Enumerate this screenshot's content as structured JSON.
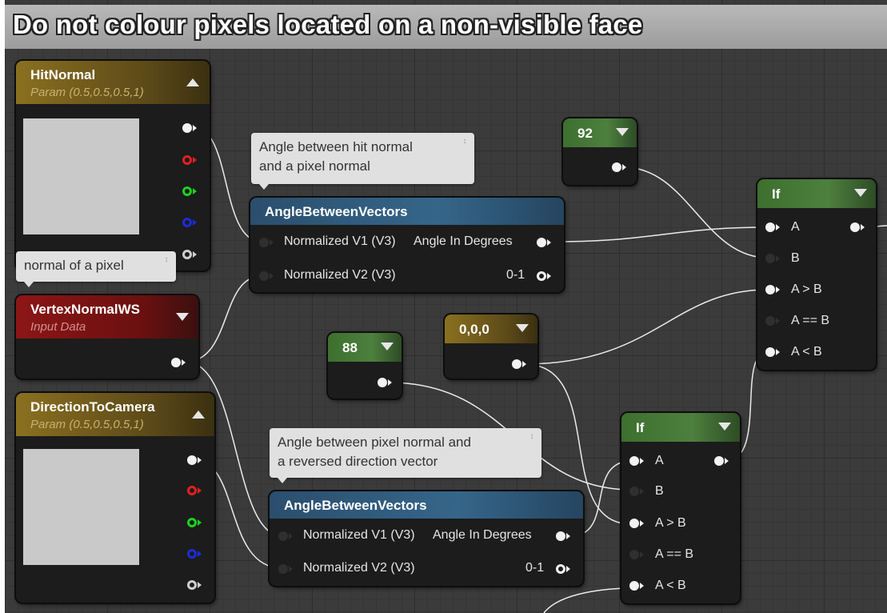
{
  "title": "Do not colour pixels located on a non-visible face",
  "nodes": {
    "hitnormal": {
      "title": "HitNormal",
      "subtitle": "Param (0.5,0.5,0.5,1)"
    },
    "vertexnormal": {
      "title": "VertexNormalWS",
      "subtitle": "Input Data"
    },
    "dircamera": {
      "title": "DirectionToCamera",
      "subtitle": "Param (0.5,0.5,0.5,1)"
    },
    "angle1": {
      "title": "AngleBetweenVectors",
      "in1": "Normalized V1 (V3)",
      "in2": "Normalized V2 (V3)",
      "out1": "Angle In Degrees",
      "out2": "0-1"
    },
    "angle2": {
      "title": "AngleBetweenVectors",
      "in1": "Normalized V1 (V3)",
      "in2": "Normalized V2 (V3)",
      "out1": "Angle In Degrees",
      "out2": "0-1"
    },
    "const92": {
      "value": "92"
    },
    "const88": {
      "value": "88"
    },
    "const000": {
      "value": "0,0,0"
    },
    "if1": {
      "title": "If",
      "pins": [
        "A",
        "B",
        "A > B",
        "A == B",
        "A < B"
      ]
    },
    "if2": {
      "title": "If",
      "pins": [
        "A",
        "B",
        "A > B",
        "A == B",
        "A < B"
      ]
    }
  },
  "comments": {
    "c1": "Angle between hit normal\nand a pixel normal",
    "c2": "normal of a pixel",
    "c3": "Angle between pixel normal and\na reversed direction vector"
  },
  "colors": {
    "canvas": "#3b3b3b",
    "param_header": "#8a7020",
    "input_header": "#8c1616",
    "if_header": "#3d6f2e",
    "func_header": "#2b4e6d"
  },
  "icons": [
    "collapse-arrow-icon",
    "expand-arrow-icon",
    "pin-icon",
    "exec-pin-icon"
  ]
}
